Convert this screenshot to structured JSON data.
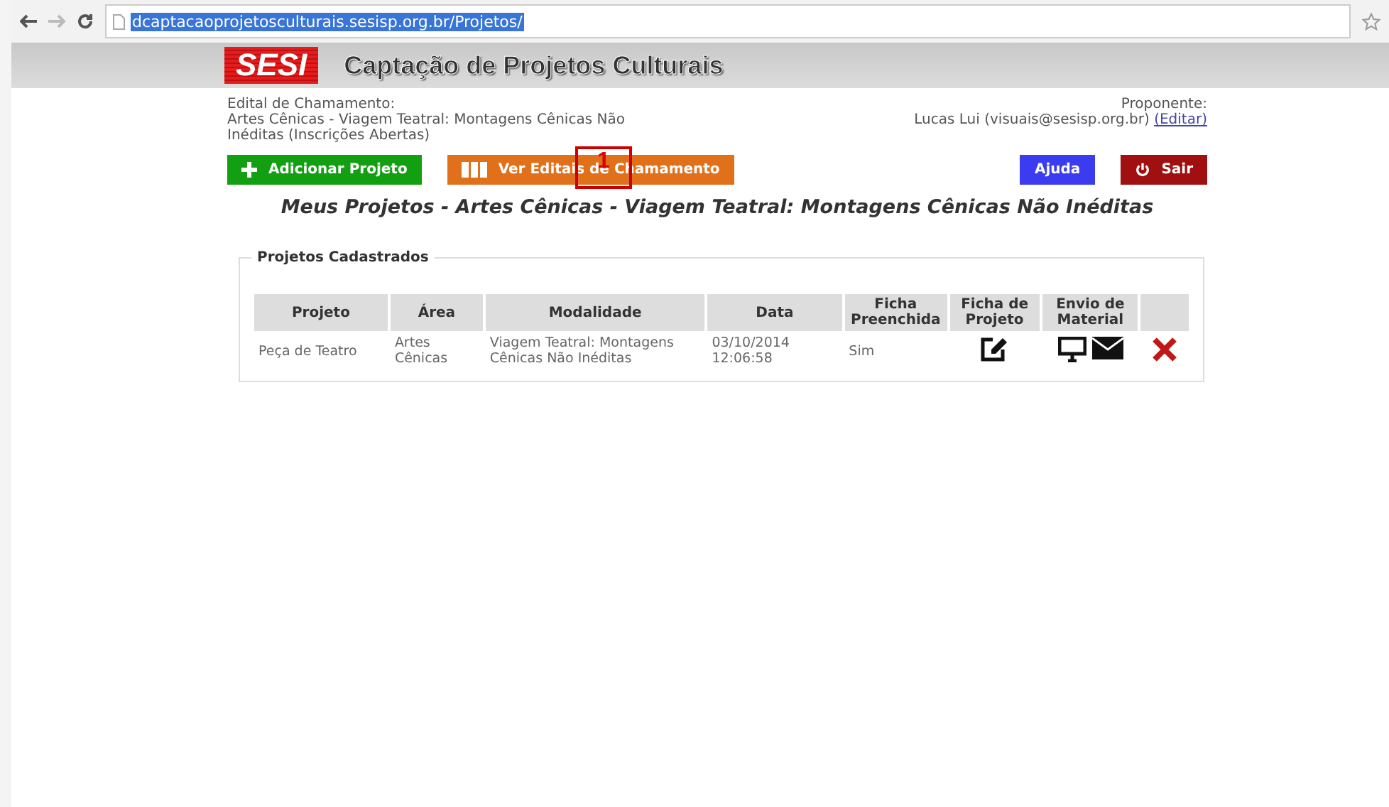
{
  "browser": {
    "url": "dcaptacaoprojetosculturais.sesisp.org.br/Projetos/"
  },
  "header": {
    "logo": "SESI",
    "title": "Captação de Projetos Culturais"
  },
  "edital": {
    "label": "Edital de Chamamento:",
    "value": "Artes Cênicas - Viagem Teatral: Montagens Cênicas Não Inéditas (Inscrições Abertas)"
  },
  "proponente": {
    "label": "Proponente:",
    "value": "Lucas Lui (visuais@sesisp.org.br)",
    "link": "(Editar)"
  },
  "actions": [
    {
      "label": "Adicionar Projeto",
      "kind": "add"
    },
    {
      "label": "Ver Editais de Chamamento",
      "kind": "list"
    }
  ],
  "actions_right": [
    {
      "label": "Ajuda",
      "kind": "help"
    },
    {
      "label": "Sair",
      "kind": "exit"
    }
  ],
  "callout": {
    "number": "1"
  },
  "heading": "Meus Projetos - Artes Cênicas - Viagem Teatral: Montagens Cênicas Não Inéditas",
  "table": {
    "legend": "Projetos Cadastrados",
    "columns": [
      "Projeto",
      "Área",
      "Modalidade",
      "Data",
      "Ficha Preenchida",
      "Ficha de Projeto",
      "Envio de Material"
    ],
    "rows": [
      {
        "projeto": "Peça de Teatro",
        "area": "Artes Cênicas",
        "modalidade": "Viagem Teatral: Montagens Cênicas Não Inéditas",
        "data": "03/10/2014 12:06:58",
        "ficha_preenchida": "Sim"
      }
    ]
  }
}
